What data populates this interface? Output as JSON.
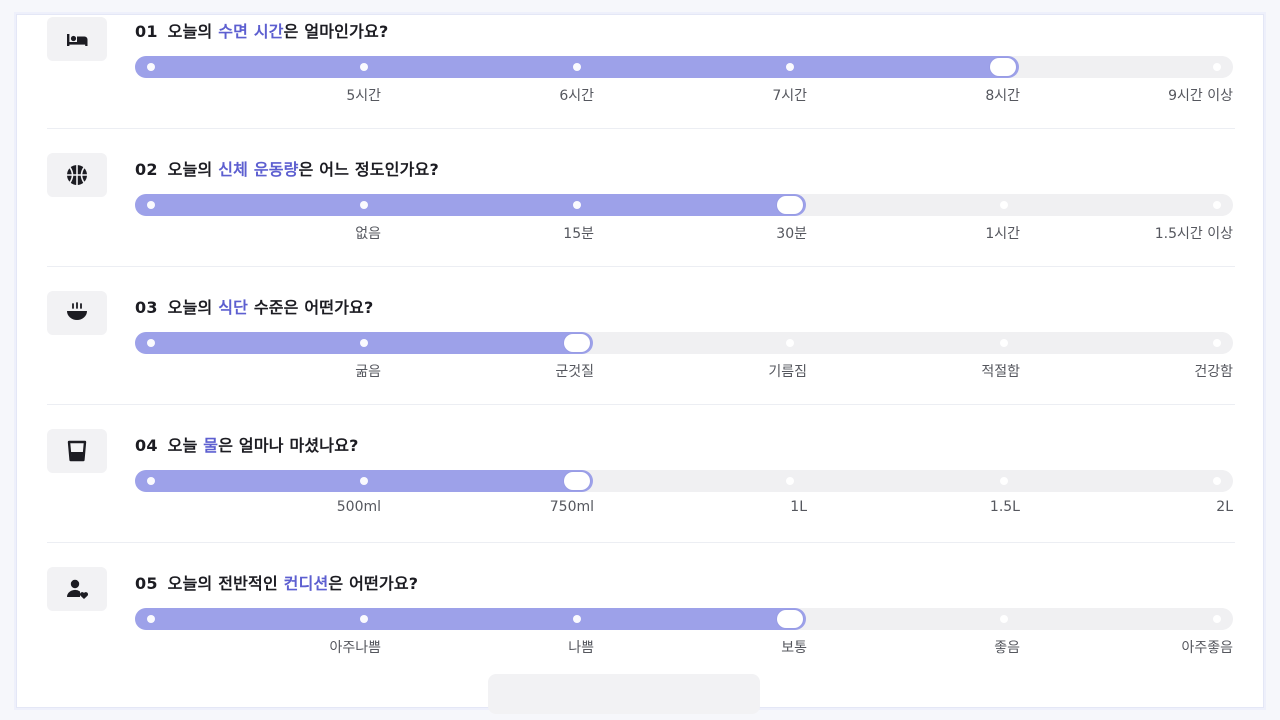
{
  "questions": [
    {
      "number": "01",
      "title_pre": "오늘의 ",
      "title_highlight": "수면 시간",
      "title_post": "은 얼마인가요?",
      "icon": "bed-icon",
      "options": [
        "5시간",
        "6시간",
        "7시간",
        "8시간",
        "9시간 이상"
      ],
      "selected_index": 4
    },
    {
      "number": "02",
      "title_pre": "오늘의 ",
      "title_highlight": "신체 운동량",
      "title_post": "은 어느 정도인가요?",
      "icon": "basketball-icon",
      "options": [
        "없음",
        "15분",
        "30분",
        "1시간",
        "1.5시간 이상"
      ],
      "selected_index": 3
    },
    {
      "number": "03",
      "title_pre": "오늘의 ",
      "title_highlight": "식단",
      "title_post": " 수준은 어떤가요?",
      "icon": "rice-bowl-icon",
      "options": [
        "굶음",
        "군것질",
        "기름짐",
        "적절함",
        "건강함"
      ],
      "selected_index": 2
    },
    {
      "number": "04",
      "title_pre": "오늘 ",
      "title_highlight": "물",
      "title_post": "은 얼마나 마셨나요?",
      "icon": "water-glass-icon",
      "options": [
        "500ml",
        "750ml",
        "1L",
        "1.5L",
        "2L"
      ],
      "selected_index": 2
    },
    {
      "number": "05",
      "title_pre": "오늘의 전반적인 ",
      "title_highlight": "컨디션",
      "title_post": "은 어떤가요?",
      "icon": "person-heart-icon",
      "options": [
        "아주나쁨",
        "나쁨",
        "보통",
        "좋음",
        "아주좋음"
      ],
      "selected_index": 3
    }
  ],
  "colors": {
    "accent": "#5d5fd0",
    "slider_fill": "#9da1e9",
    "slider_track": "#f0f0f2"
  }
}
